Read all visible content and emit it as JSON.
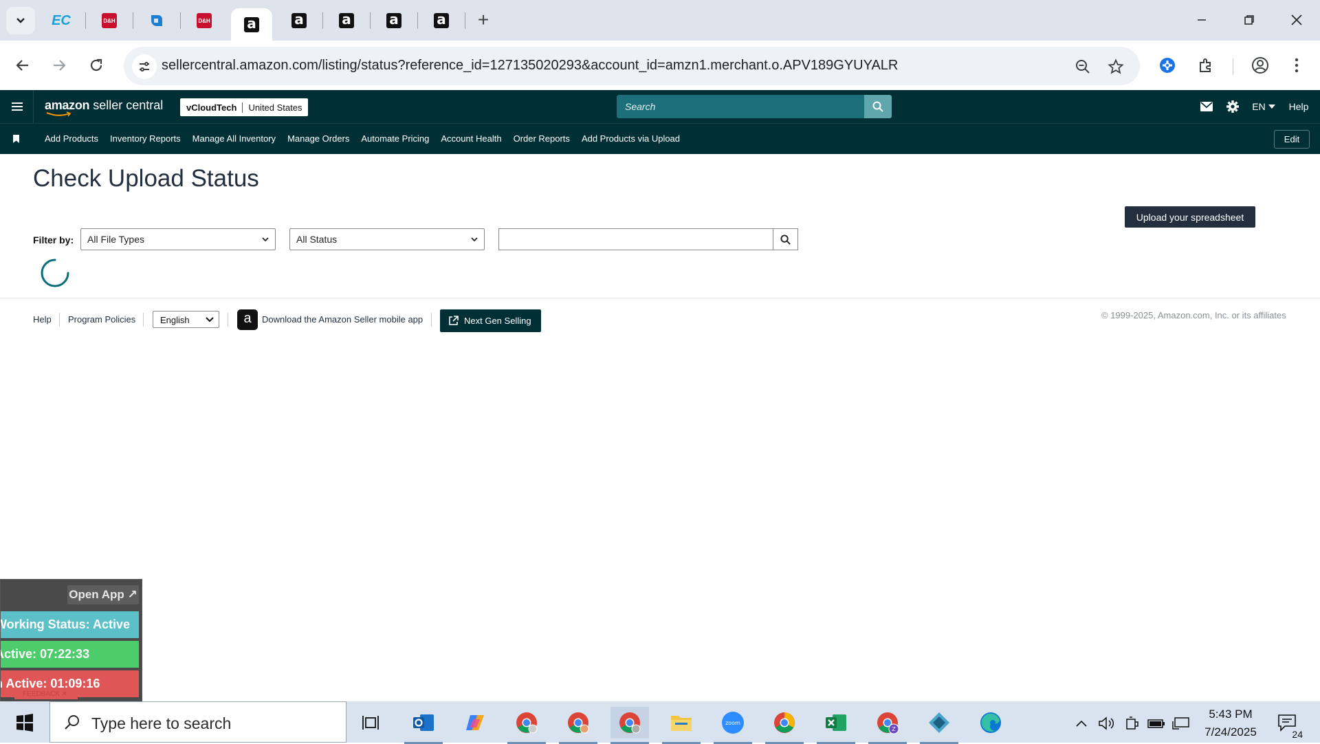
{
  "browser": {
    "tabs": [
      {
        "icon": "ec-favicon",
        "text": "EC"
      },
      {
        "icon": "dh-favicon",
        "text": "D&H"
      },
      {
        "icon": "q-favicon",
        "text": ""
      },
      {
        "icon": "dh-favicon",
        "text": "D&H"
      },
      {
        "icon": "amazon-favicon",
        "text": "a",
        "active": true
      },
      {
        "icon": "amazon-favicon",
        "text": "a"
      },
      {
        "icon": "amazon-favicon",
        "text": "a"
      },
      {
        "icon": "amazon-favicon",
        "text": "a"
      },
      {
        "icon": "amazon-favicon",
        "text": "a"
      }
    ],
    "url": "sellercentral.amazon.com/listing/status?reference_id=127135020293&account_id=amzn1.merchant.o.APV189GYUYALR"
  },
  "header": {
    "logo_bold": "amazon",
    "logo_rest": " seller central",
    "merchant_name": "vCloudTech",
    "marketplace": "United States",
    "search_placeholder": "Search",
    "language": "EN",
    "help": "Help"
  },
  "nav": {
    "items": [
      "Add Products",
      "Inventory Reports",
      "Manage All Inventory",
      "Manage Orders",
      "Automate Pricing",
      "Account Health",
      "Order Reports",
      "Add Products via Upload"
    ],
    "edit": "Edit"
  },
  "main": {
    "title": "Check Upload Status",
    "upload_button": "Upload your spreadsheet",
    "filter_label": "Filter by:",
    "file_type_select": "All File Types",
    "status_select": "All Status",
    "search_value": ""
  },
  "footer": {
    "help": "Help",
    "program_policies": "Program Policies",
    "language": "English",
    "download_app": "Download the Amazon Seller mobile app",
    "next_gen": "Next Gen Selling",
    "copyright": "© 1999-2025, Amazon.com, Inc. or its affiliates"
  },
  "widget": {
    "open_app": "Open App ↗",
    "working_status": "Working Status: Active",
    "active_time": "Active: 07:22:33",
    "inactive_time": "n Active: 01:09:16",
    "feedback": "FEEDBACK ✕"
  },
  "taskbar": {
    "search_placeholder": "Type here to search",
    "time": "5:43 PM",
    "date": "7/24/2025",
    "notification_count": "24"
  },
  "colors": {
    "header_bg": "#002f36",
    "search_bg": "#1c6e78",
    "upload_button_bg": "#232f3e",
    "status_active": "#5bc0c8",
    "active_green": "#4ccc6a",
    "inactive_red": "#e05555"
  }
}
